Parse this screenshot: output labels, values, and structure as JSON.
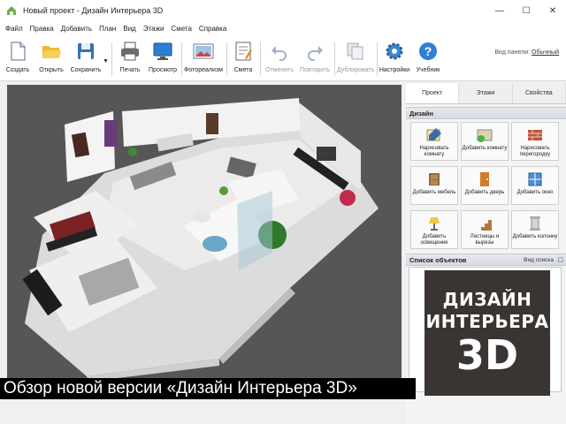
{
  "window": {
    "title": "Новый проект - Дизайн Интерьера 3D",
    "controls": [
      "—",
      "☐",
      "✕"
    ]
  },
  "menu": [
    "Файл",
    "Правка",
    "Добавить",
    "План",
    "Вид",
    "Этажи",
    "Смета",
    "Справка"
  ],
  "toolbar": {
    "buttons": [
      {
        "label": "Создать",
        "icon": "new-document-icon",
        "enabled": true
      },
      {
        "label": "Открыть",
        "icon": "folder-open-icon",
        "enabled": true
      },
      {
        "label": "Сохранить",
        "icon": "floppy-disk-icon",
        "enabled": true
      },
      {
        "label": "Печать",
        "icon": "printer-icon",
        "enabled": true
      },
      {
        "label": "Просмотр",
        "icon": "monitor-icon",
        "enabled": true
      },
      {
        "label": "Фотореализм",
        "icon": "photo-icon",
        "enabled": true
      },
      {
        "label": "Смета",
        "icon": "estimate-icon",
        "enabled": true
      },
      {
        "label": "Отменить",
        "icon": "undo-icon",
        "enabled": false
      },
      {
        "label": "Повторить",
        "icon": "redo-icon",
        "enabled": false
      },
      {
        "label": "Дублировать",
        "icon": "duplicate-icon",
        "enabled": false
      },
      {
        "label": "Настройки",
        "icon": "gear-icon",
        "enabled": true
      },
      {
        "label": "Учебник",
        "icon": "help-icon",
        "enabled": true
      }
    ],
    "panel_view_label": "Вид панели:",
    "panel_view_value": "Обычный"
  },
  "side_panel": {
    "tabs": [
      "Проект",
      "Этажи",
      "Свойства"
    ],
    "active_tab": "Проект",
    "design_header": "Дизайн",
    "design_buttons": [
      {
        "label": "Нарисовать комнату",
        "icon": "draw-room-icon"
      },
      {
        "label": "Добавить комнату",
        "icon": "add-room-icon"
      },
      {
        "label": "Нарисовать перегородку",
        "icon": "wall-icon"
      },
      {
        "label": "Добавить мебель",
        "icon": "furniture-icon"
      },
      {
        "label": "Добавить дверь",
        "icon": "door-icon"
      },
      {
        "label": "Добавить окно",
        "icon": "window-icon"
      },
      {
        "label": "Добавить освещение",
        "icon": "lamp-icon"
      },
      {
        "label": "Лестницы и вырезы",
        "icon": "stairs-icon"
      },
      {
        "label": "Добавить колонну",
        "icon": "column-icon"
      }
    ],
    "objects_header": "Список объектов",
    "objects_view_label": "Вид списка",
    "objects_close": "▢"
  },
  "promo": {
    "line1": "ДИЗАЙН",
    "line2": "ИНТЕРЬЕРА",
    "line3": "3D"
  },
  "caption": "Обзор новой версии «Дизайн Интерьера 3D»"
}
